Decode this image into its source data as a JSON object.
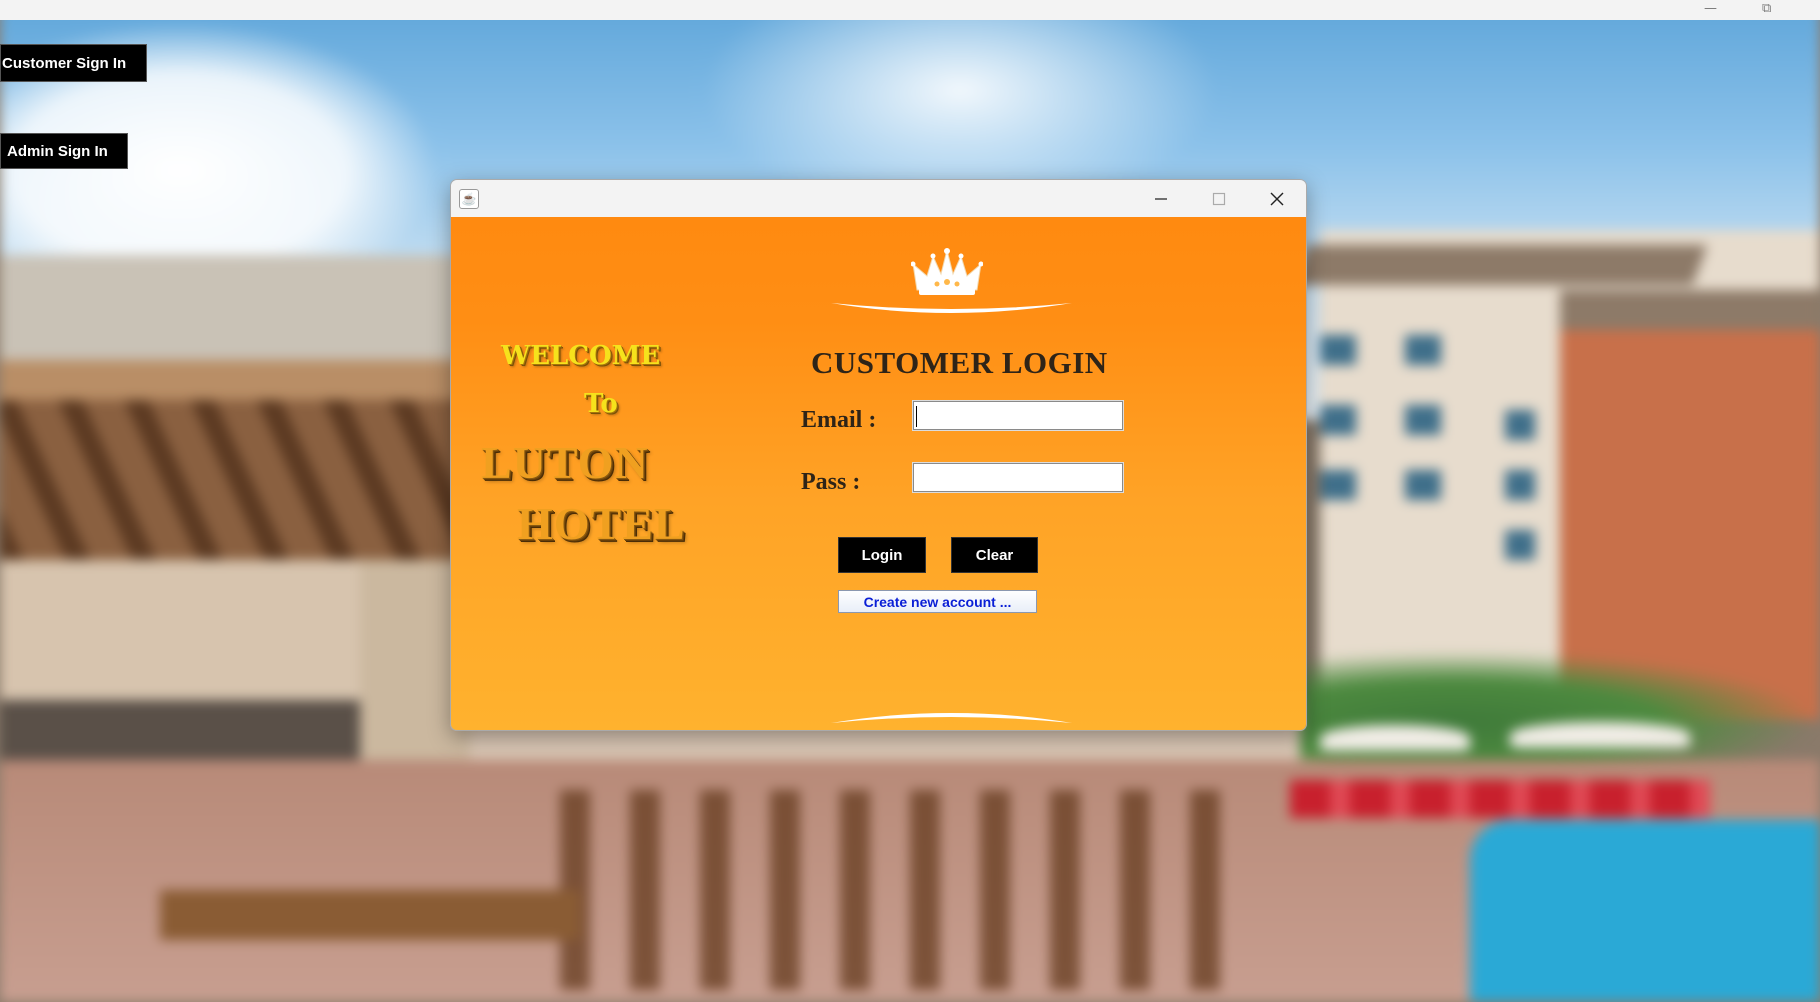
{
  "window": {
    "minimize_glyph": "—",
    "restore_glyph": "⧉"
  },
  "side_menu": {
    "customer_label": "Customer Sign In",
    "admin_label": "Admin Sign In"
  },
  "dialog": {
    "title": "",
    "welcome": {
      "line1": "WELCOME",
      "line2": "To",
      "line3": "LUTON",
      "line4": "HOTEL"
    },
    "heading": "CUSTOMER LOGIN",
    "email_label": "Email :",
    "email_value": "",
    "pass_label": "Pass :",
    "pass_value": "",
    "login_label": "Login",
    "clear_label": "Clear",
    "create_label": "Create new account ..."
  },
  "colors": {
    "dialog_top": "#ff8a10",
    "dialog_bottom": "#ffb22e",
    "heading": "#2e2418",
    "welcome_text": "#f6e21c",
    "link_text": "#0a1fd6"
  },
  "icons": [
    "java-app-icon",
    "minimize-icon",
    "maximize-icon",
    "close-icon",
    "crown-icon"
  ]
}
